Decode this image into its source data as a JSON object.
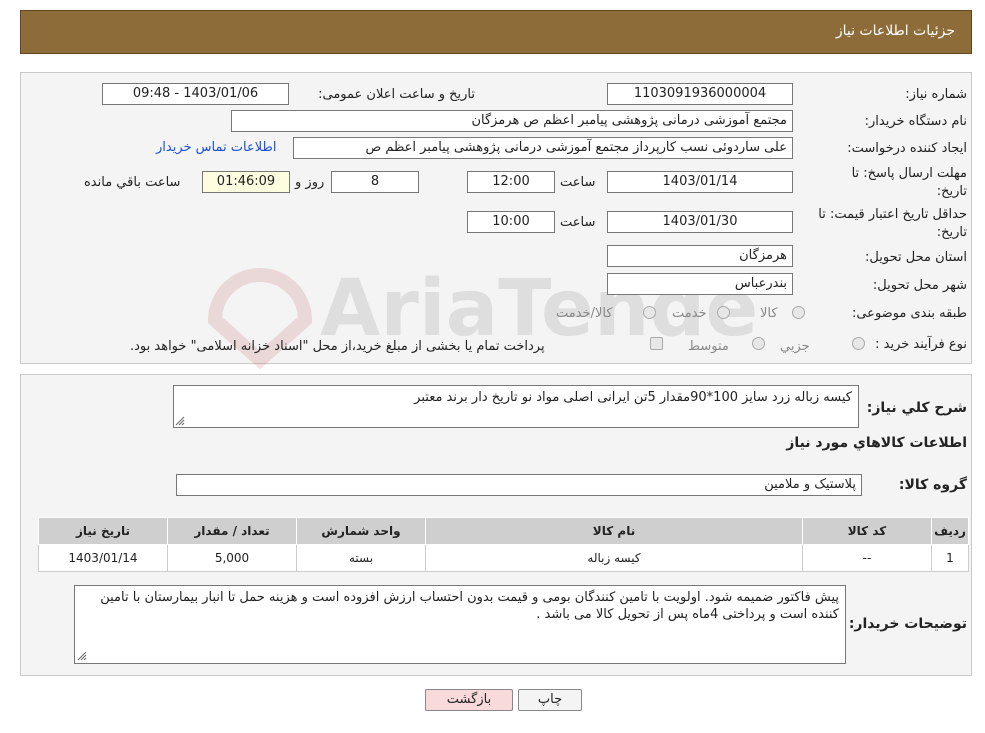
{
  "header": {
    "title": "جزئیات اطلاعات نیاز"
  },
  "form": {
    "need_number_label": "شماره نیاز:",
    "need_number": "1103091936000004",
    "announce_label": "تاریخ و ساعت اعلان عمومی:",
    "announce_value": "1403/01/06 - 09:48",
    "buyer_label": "نام دستگاه خریدار:",
    "buyer_value": "مجتمع آموزشی درمانی پژوهشی پیامبر اعظم ص  هرمزگان",
    "creator_label": "ایجاد کننده درخواست:",
    "creator_value": "علی ساردوئی نسب کارپرداز مجتمع آموزشی درمانی پژوهشی پیامبر اعظم ص",
    "contact_link": "اطلاعات تماس خریدار",
    "deadline_label_1": "مهلت ارسال پاسخ: تا",
    "deadline_label_2": "تاریخ:",
    "deadline_date": "1403/01/14",
    "time_label": "ساعت",
    "deadline_time": "12:00",
    "days_value": "8",
    "days_label": "روز و",
    "remaining_value": "01:46:09",
    "remaining_label": "ساعت باقي مانده",
    "validity_label_1": "حداقل تاریخ اعتبار قیمت: تا",
    "validity_label_2": "تاریخ:",
    "validity_date": "1403/01/30",
    "validity_time_label": "ساعت",
    "validity_time": "10:00",
    "province_label": "استان محل تحویل:",
    "province_value": "هرمزگان",
    "city_label": "شهر محل تحویل:",
    "city_value": "بندرعباس",
    "category_label": "طبقه بندی موضوعی:",
    "category_options": [
      "کالا",
      "خدمت",
      "کالا/خدمت"
    ],
    "process_label": "نوع فرآیند خرید :",
    "process_options": [
      "جزیي",
      "متوسط"
    ],
    "process_note": "پرداخت تمام یا بخشی از مبلغ خرید،از محل \"اسناد خزانه اسلامی\" خواهد بود."
  },
  "details": {
    "description_label": "شرح کلي نياز:",
    "description_value": "کیسه زباله زرد سایز 100*90مقدار 5تن ایرانی اصلی مواد نو تاریخ دار برند معتبر",
    "goods_info_title": "اطلاعات کالاهاي مورد نياز",
    "group_label": "گروه کالا:",
    "group_value": "پلاستیک و ملامین",
    "table": {
      "headers": [
        "رديف",
        "کد کالا",
        "نام کالا",
        "واحد شمارش",
        "تعداد / مقدار",
        "تاریخ نیاز"
      ],
      "rows": [
        [
          "1",
          "--",
          "کیسه زباله",
          "بسته",
          "5,000",
          "1403/01/14"
        ]
      ]
    },
    "buyer_notes_label": "توضیحات خریدار:",
    "buyer_notes_value": "پیش فاکتور ضمیمه شود. اولویت با تامین کنندگان بومی و قیمت بدون احتساب ارزش افزوده است و هزینه حمل تا انبار بیمارستان با تامین کننده است و پرداختی 4ماه پس از تحویل  کالا می باشد ."
  },
  "buttons": {
    "print": "چاپ",
    "back": "بازگشت"
  },
  "watermark": {
    "text": "AriaTender.neT"
  },
  "colors": {
    "header_bg": "#8e6c3a",
    "link": "#1a4fd6",
    "back_button_bg": "#f9dada"
  }
}
